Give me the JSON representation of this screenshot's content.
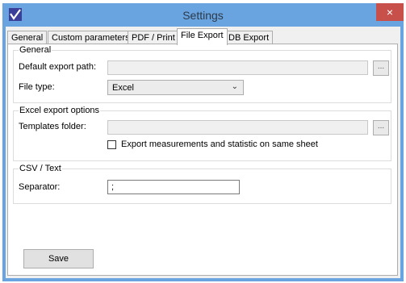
{
  "window": {
    "title": "Settings",
    "close_symbol": "×",
    "app_icon": "checkmark-app-icon"
  },
  "tabs": [
    {
      "label": "General"
    },
    {
      "label": "Custom parameters"
    },
    {
      "label": "PDF / Print"
    },
    {
      "label": "File Export"
    },
    {
      "label": "DB Export"
    }
  ],
  "active_tab": "File Export",
  "general_group": {
    "title": "General",
    "export_path_label": "Default export path:",
    "export_path_value": "",
    "browse_label": "...",
    "file_type_label": "File type:",
    "file_type_value": "Excel"
  },
  "excel_group": {
    "title": "Excel export options",
    "templates_label": "Templates folder:",
    "templates_value": "",
    "browse_label": "...",
    "same_sheet_label": "Export measurements and statistic on same sheet",
    "same_sheet_checked": false
  },
  "csv_group": {
    "title": "CSV / Text",
    "separator_label": "Separator:",
    "separator_value": ";"
  },
  "save_label": "Save",
  "colors": {
    "title_bar": "#6aa4e0",
    "close_button": "#c7504a",
    "client_bg": "#f0f0f0",
    "panel_bg": "#ffffff"
  }
}
